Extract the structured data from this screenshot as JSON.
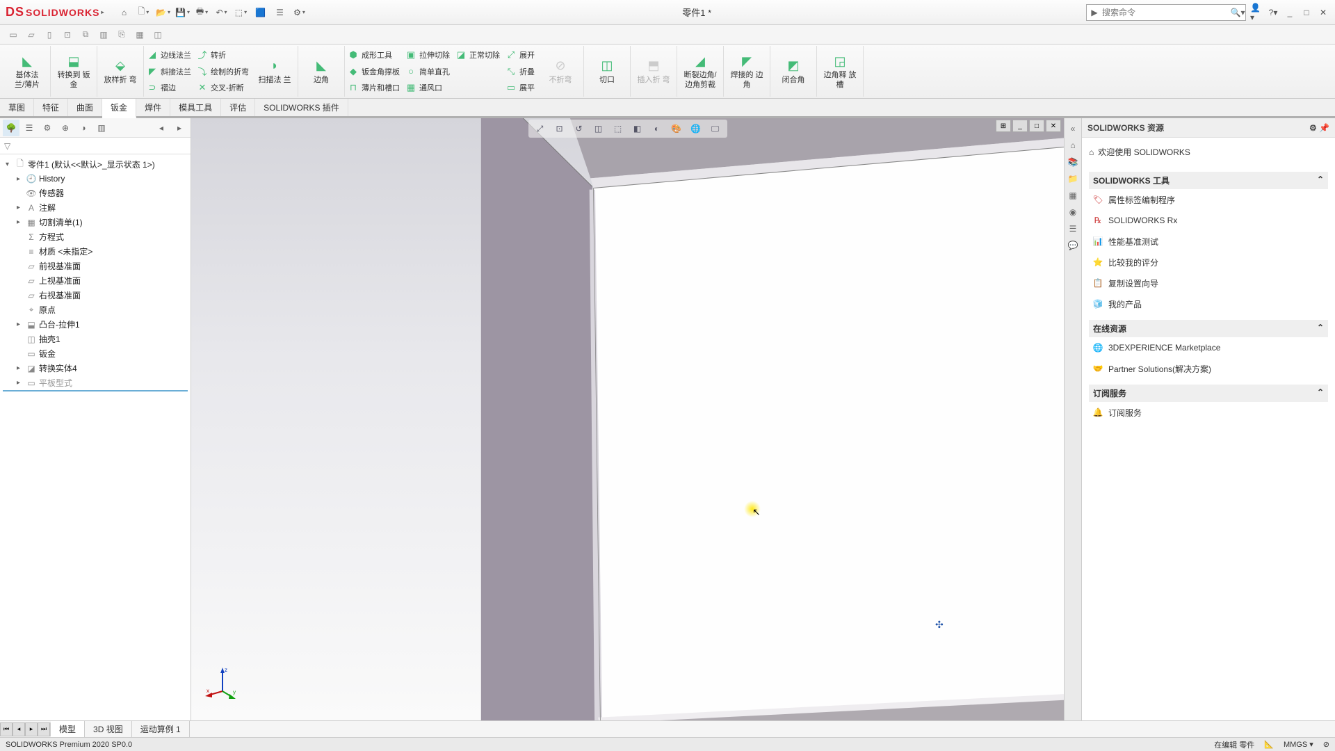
{
  "app": {
    "logo_prefix": "DS",
    "logo_text": "SOLIDWORKS",
    "document_title": "零件1 *",
    "search_placeholder": "搜索命令"
  },
  "ribbon": {
    "big1": "基体法\n兰/薄片",
    "big2": "转换到\n钣金",
    "big3": "放样折\n弯",
    "col1": {
      "a": "边线法兰",
      "b": "斜接法兰",
      "c": "褶边"
    },
    "col2": {
      "a": "转折",
      "b": "绘制的折弯",
      "c": "交叉-折断"
    },
    "big4": "扫描法\n兰",
    "big5": "边角",
    "col3": {
      "a": "成形工具",
      "b": "钣金角撑板",
      "c": "薄片和槽口"
    },
    "col4": {
      "a": "拉伸切除",
      "b": "简单直孔",
      "c": "通风口"
    },
    "col5": {
      "a": "正常切除"
    },
    "col6": {
      "a": "展开",
      "b": "折叠",
      "c": "展平"
    },
    "big6": "不折弯",
    "big7": "切口",
    "big8": "插入折\n弯",
    "big9": "断裂边角/\n边角剪裁",
    "big10": "焊接的\n边角",
    "big11": "闭合角",
    "big12": "边角释\n放槽"
  },
  "tabs": [
    "草图",
    "特征",
    "曲面",
    "钣金",
    "焊件",
    "模具工具",
    "评估",
    "SOLIDWORKS 插件"
  ],
  "tree": {
    "root": "零件1 (默认<<默认>_显示状态 1>)",
    "items": [
      "History",
      "传感器",
      "注解",
      "切割清单(1)",
      "方程式",
      "材质 <未指定>",
      "前视基准面",
      "上视基准面",
      "右视基准面",
      "原点",
      "凸台-拉伸1",
      "抽壳1",
      "钣金",
      "转换实体4",
      "平板型式"
    ]
  },
  "taskpane": {
    "title": "SOLIDWORKS 资源",
    "welcome": "欢迎使用  SOLIDWORKS",
    "section1": "SOLIDWORKS 工具",
    "links1": [
      "属性标签编制程序",
      "SOLIDWORKS Rx",
      "性能基准测试",
      "比较我的评分",
      "复制设置向导",
      "我的产品"
    ],
    "section2": "在线资源",
    "links2": [
      "3DEXPERIENCE Marketplace",
      "Partner Solutions(解决方案)"
    ],
    "section3": "订阅服务",
    "links3": [
      "订阅服务"
    ]
  },
  "bottom_tabs": [
    "模型",
    "3D 视图",
    "运动算例 1"
  ],
  "status": {
    "left": "SOLIDWORKS Premium 2020 SP0.0",
    "editing": "在编辑 零件",
    "units": "MMGS"
  },
  "triad": {
    "x": "x",
    "y": "y",
    "z": "z"
  }
}
